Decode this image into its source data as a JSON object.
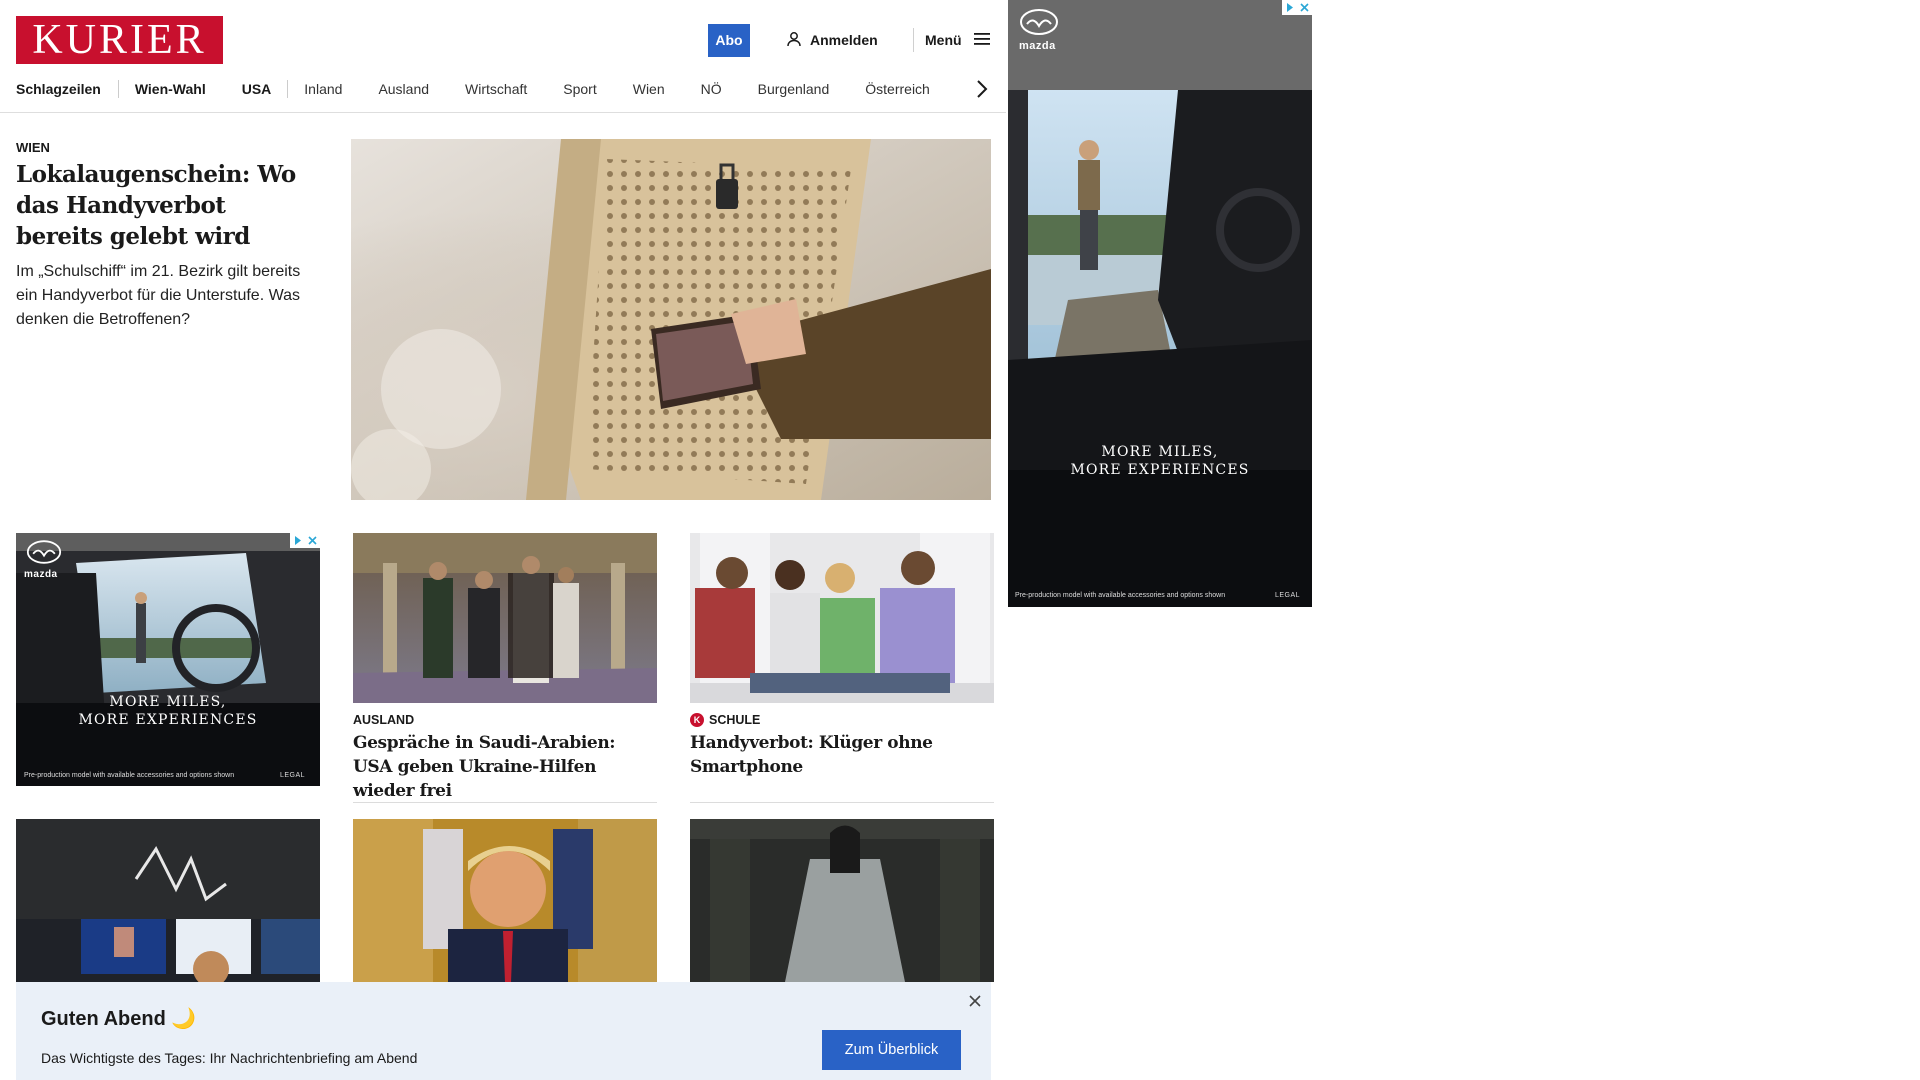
{
  "header": {
    "logo": "KURIER",
    "abo_label": "Abo",
    "login_label": "Anmelden",
    "menu_label": "Menü"
  },
  "nav": {
    "items": [
      "Schlagzeilen",
      "Wien-Wahl",
      "USA",
      "Inland",
      "Ausland",
      "Wirtschaft",
      "Sport",
      "Wien",
      "NÖ",
      "Burgenland",
      "Österreich"
    ]
  },
  "lead": {
    "section": "WIEN",
    "title": "Lokalaugenschein: Wo das Handyverbot bereits gelebt wird",
    "teaser": "Im „Schulschiff“ im 21. Bezirk gilt bereits ein Handyverbot für die Unterstufe. Was denken die Betroffenen?"
  },
  "ad": {
    "brand": "mazda",
    "slogan_line1": "MORE MILES,",
    "slogan_line2": "MORE EXPERIENCES",
    "fineprint": "Pre-production model with available accessories and options shown",
    "legal": "LEGAL"
  },
  "cards": [
    {
      "section": "AUSLAND",
      "title": "Gespräche in Saudi-Arabien: USA geben Ukraine-Hilfen wieder frei"
    },
    {
      "section": "SCHULE",
      "title": "Handyverbot: Klüger ohne Smartphone"
    }
  ],
  "briefing": {
    "title": "Guten Abend 🌙",
    "text": "Das Wichtigste des Tages: Ihr Nachrichtenbriefing am Abend",
    "button": "Zum Überblick"
  }
}
